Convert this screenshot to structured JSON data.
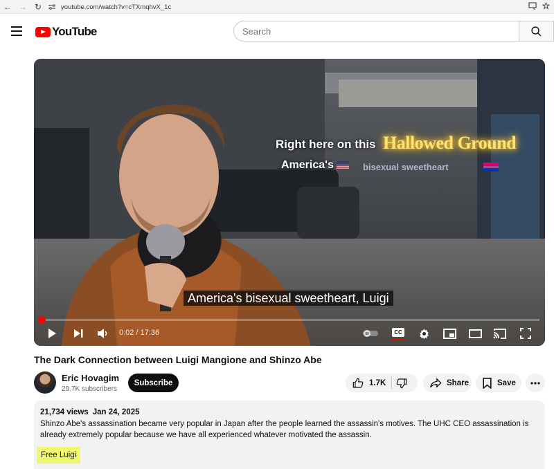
{
  "browser": {
    "url": "youtube.com/watch?v=cTXmqhvX_1c"
  },
  "header": {
    "logo_text": "YouTube",
    "search_placeholder": "Search"
  },
  "player": {
    "overlay_line1": "Right here on this",
    "overlay_highlight": "Hallowed Ground",
    "overlay_line2": "America's",
    "overlay_line2_faded": "bisexual sweetheart",
    "subtitle": "America's bisexual sweetheart, Luigi",
    "current_time": "0:02",
    "duration": "17:36",
    "time_display": "0:02 / 17:36",
    "progress_fraction": 0.002,
    "cc_label": "CC"
  },
  "video": {
    "title": "The Dark Connection between Luigi Mangione and Shinzo Abe",
    "channel_name": "Eric Hovagim",
    "subscribers": "29.7K subscribers",
    "subscribe_label": "Subscribe",
    "likes": "1.7K",
    "share_label": "Share",
    "save_label": "Save"
  },
  "description": {
    "views": "21,734 views",
    "date": "Jan 24, 2025",
    "text": "Shinzo Abe's assassination became very popular in Japan after the people learned the assassin's motives. The UHC CEO assassination is already extremely popular because we have all experienced whatever motivated the assassin.",
    "tag": "Free Luigi"
  },
  "colors": {
    "brand_red": "#ff0000",
    "highlight_yellow": "#f0f870"
  }
}
